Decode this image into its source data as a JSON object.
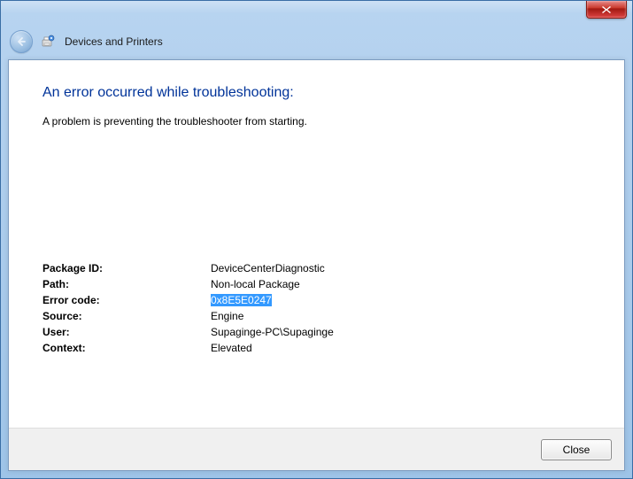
{
  "window": {
    "breadcrumb": "Devices and Printers"
  },
  "error": {
    "title": "An error occurred while troubleshooting:",
    "message": "A problem is preventing the troubleshooter from starting."
  },
  "details": {
    "package_id_label": "Package ID:",
    "package_id_value": "DeviceCenterDiagnostic",
    "path_label": "Path:",
    "path_value": "Non-local Package",
    "error_code_label": "Error code:",
    "error_code_value": "0x8E5E0247",
    "source_label": "Source:",
    "source_value": "Engine",
    "user_label": "User:",
    "user_value": "Supaginge-PC\\Supaginge",
    "context_label": "Context:",
    "context_value": "Elevated"
  },
  "buttons": {
    "close": "Close"
  }
}
